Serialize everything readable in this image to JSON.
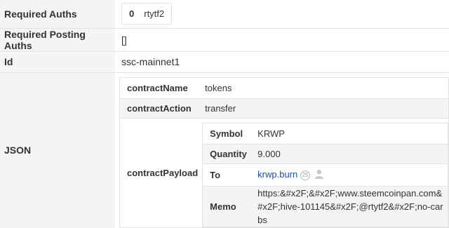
{
  "required_auths": {
    "label": "Required Auths",
    "index": "0",
    "value": "rtytf2"
  },
  "required_posting_auths": {
    "label": "Required Posting Auths",
    "value": "[]"
  },
  "id": {
    "label": "Id",
    "value": "ssc-mainnet1"
  },
  "json": {
    "label": "JSON",
    "contract_name": {
      "label": "contractName",
      "value": "tokens"
    },
    "contract_action": {
      "label": "contractAction",
      "value": "transfer"
    },
    "contract_payload": {
      "label": "contractPayload",
      "symbol": {
        "label": "Symbol",
        "value": "KRWP"
      },
      "quantity": {
        "label": "Quantity",
        "value": "9.000"
      },
      "to": {
        "label": "To",
        "value": "krwp.burn",
        "reputation": "25"
      },
      "memo": {
        "label": "Memo",
        "value": "https:&#x2F;&#x2F;www.steemcoinpan.com&#x2F;hive-101145&#x2F;@rtytf2&#x2F;no-carbs"
      }
    }
  },
  "colors": {
    "link": "#1f4ea0",
    "row_bg": "#f4f4f4",
    "border": "#e3e3e3"
  },
  "icons": [
    "user-icon"
  ]
}
